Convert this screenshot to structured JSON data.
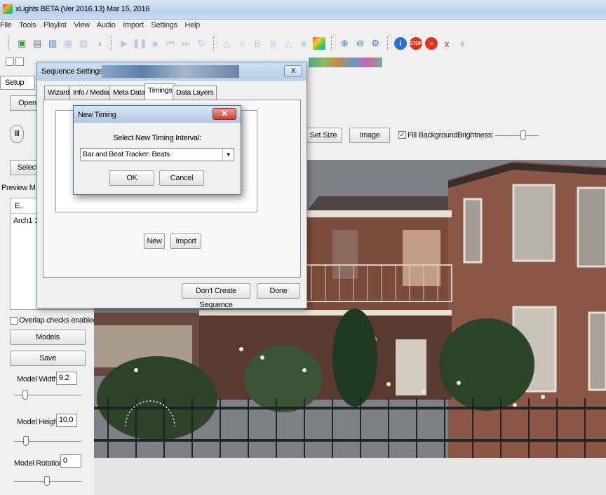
{
  "window": {
    "title": "xLights BETA (Ver 2016.13) Mar 15, 2016"
  },
  "menu": {
    "items": [
      "File",
      "Tools",
      "Playlist",
      "View",
      "Audio",
      "Import",
      "Settings",
      "Help"
    ]
  },
  "toolbar": {
    "icons": [
      "new-sequence-icon",
      "open-file-icon",
      "save-icon",
      "save-as-icon",
      "save-all-icon",
      "render-icon",
      "play-icon",
      "pause-icon",
      "stop-icon",
      "first-frame-icon",
      "last-frame-icon",
      "replay-icon",
      "effect-a-icon",
      "effect-b-icon",
      "effect-c-icon",
      "effect-d-icon",
      "effect-e-icon",
      "effect-f-icon",
      "palette-icon",
      "zoom-in-icon",
      "zoom-out-icon",
      "settings-gear-icon",
      "info-icon",
      "stop-sign-icon",
      "record-icon",
      "toggle-icon",
      "help-bulb-icon"
    ]
  },
  "left_panel": {
    "tab_setup": "Setup",
    "open_button": "Open",
    "select_button": "Select",
    "preview_models_label": "Preview M",
    "list_header": "E..",
    "list_item": "Arch1  1",
    "overlap_checks": "Overlap checks enabled",
    "models_button": "Models",
    "save_button": "Save",
    "model_width_label": "Model Width",
    "model_width_value": "9.2",
    "model_height_label": "Model Height",
    "model_height_value": "10.0",
    "model_rotation_label": "Model Rotation",
    "model_rotation_value": "0"
  },
  "preview_toolbar": {
    "set_size": "Set Size",
    "image": "Image",
    "fill_background": "Fill Background",
    "brightness": "Brightness:",
    "fill_background_checked": true
  },
  "sequence_dialog": {
    "title": "Sequence Settings",
    "close": "X",
    "tabs": [
      "Wizard",
      "Info / Media",
      "Meta Data",
      "Timings",
      "Data Layers"
    ],
    "active_tab": "Timings",
    "new_button": "New",
    "import_button": "Import",
    "dont_create_button": "Don't Create Sequence",
    "done_button": "Done"
  },
  "timing_dialog": {
    "title": "New Timing",
    "prompt": "Select New Timing Interval:",
    "selected": "Bar and Beat Tracker: Beats",
    "ok": "OK",
    "cancel": "Cancel"
  },
  "colors": {
    "titlebar": "#c3d6ec",
    "dialog_bg": "#f0f0f0",
    "close_red": "#c8412e"
  }
}
